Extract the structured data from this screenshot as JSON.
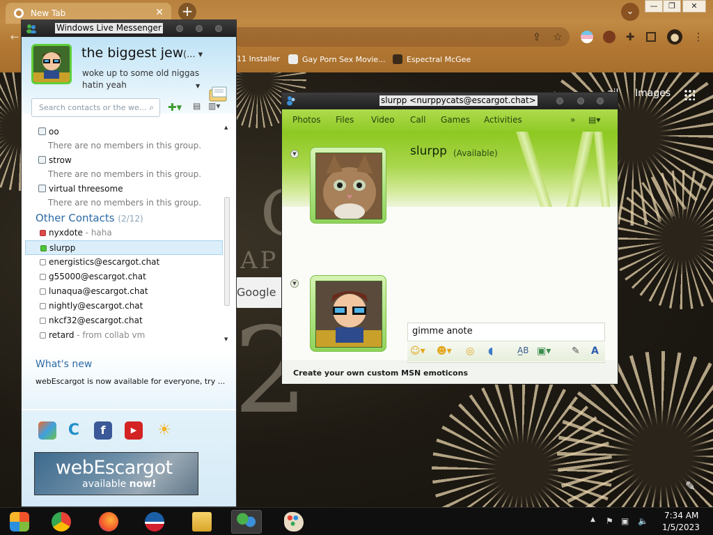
{
  "browser": {
    "tab_title": "New Tab",
    "close_glyph": "✕",
    "new_tab_glyph": "+",
    "tab_search_glyph": "⌄",
    "bookmarks": [
      {
        "label": "11 Installer"
      },
      {
        "label": "Gay Porn Sex Movie..."
      },
      {
        "label": "Espectral McGee"
      }
    ],
    "page_links": {
      "gmail_partial": "ail",
      "images": "Images"
    },
    "search_partial": "Google or",
    "window_controls": {
      "minimize": "—",
      "restore": "❐",
      "close": "✕"
    }
  },
  "messenger": {
    "window_title": "Windows Live Messenger",
    "display_name": "the biggest jew",
    "display_name_suffix": "(...",
    "status_message": "woke up to some old niggas hatin yeah",
    "search_placeholder": "Search contacts or the we...",
    "groups": [
      {
        "name": "oo",
        "empty_note": "There are no members in this group."
      },
      {
        "name": "strow",
        "empty_note": "There are no members in this group."
      },
      {
        "name": "virtual threesome",
        "empty_note": "There are no members in this group."
      }
    ],
    "other_contacts": {
      "label": "Other Contacts",
      "count": "(2/12)",
      "contacts": [
        {
          "name": "nyxdote",
          "psm": " - haha",
          "status_color": "#e04848"
        },
        {
          "name": "slurpp",
          "psm": "",
          "status_color": "#4cc43a"
        },
        {
          "name": "energistics@escargot.chat",
          "psm": "",
          "status_color": "#ffffff"
        },
        {
          "name": "g55000@escargot.chat",
          "psm": "",
          "status_color": "#ffffff"
        },
        {
          "name": "lunaqua@escargot.chat",
          "psm": "",
          "status_color": "#ffffff"
        },
        {
          "name": "nightly@escargot.chat",
          "psm": "",
          "status_color": "#ffffff"
        },
        {
          "name": "nkcf32@escargot.chat",
          "psm": "",
          "status_color": "#ffffff"
        },
        {
          "name": "retard",
          "psm": " - from collab vm",
          "status_color": "#ffffff"
        }
      ]
    },
    "whats_new_title": "What's new",
    "whats_new_body": "webEscargot is now available for everyone, try ...",
    "banner": {
      "line1": "webEscargot",
      "line2_a": "available ",
      "line2_b": "now!"
    }
  },
  "conversation": {
    "window_title": "slurpp <nurppycats@escargot.chat>",
    "menu": [
      "Photos",
      "Files",
      "Video",
      "Call",
      "Games",
      "Activities"
    ],
    "overflow_glyph": "»",
    "buddy_name": "slurpp",
    "buddy_status": "(Available)",
    "input_text": "gimme anote",
    "promo": "Create your own custom MSN emoticons"
  },
  "taskbar": {
    "time": "7:34 AM",
    "date": "1/5/2023"
  },
  "colors": {
    "msn_accent": "#2b6aa7",
    "conv_green": "#8fca26",
    "online": "#4cc43a",
    "busy": "#e04848"
  }
}
